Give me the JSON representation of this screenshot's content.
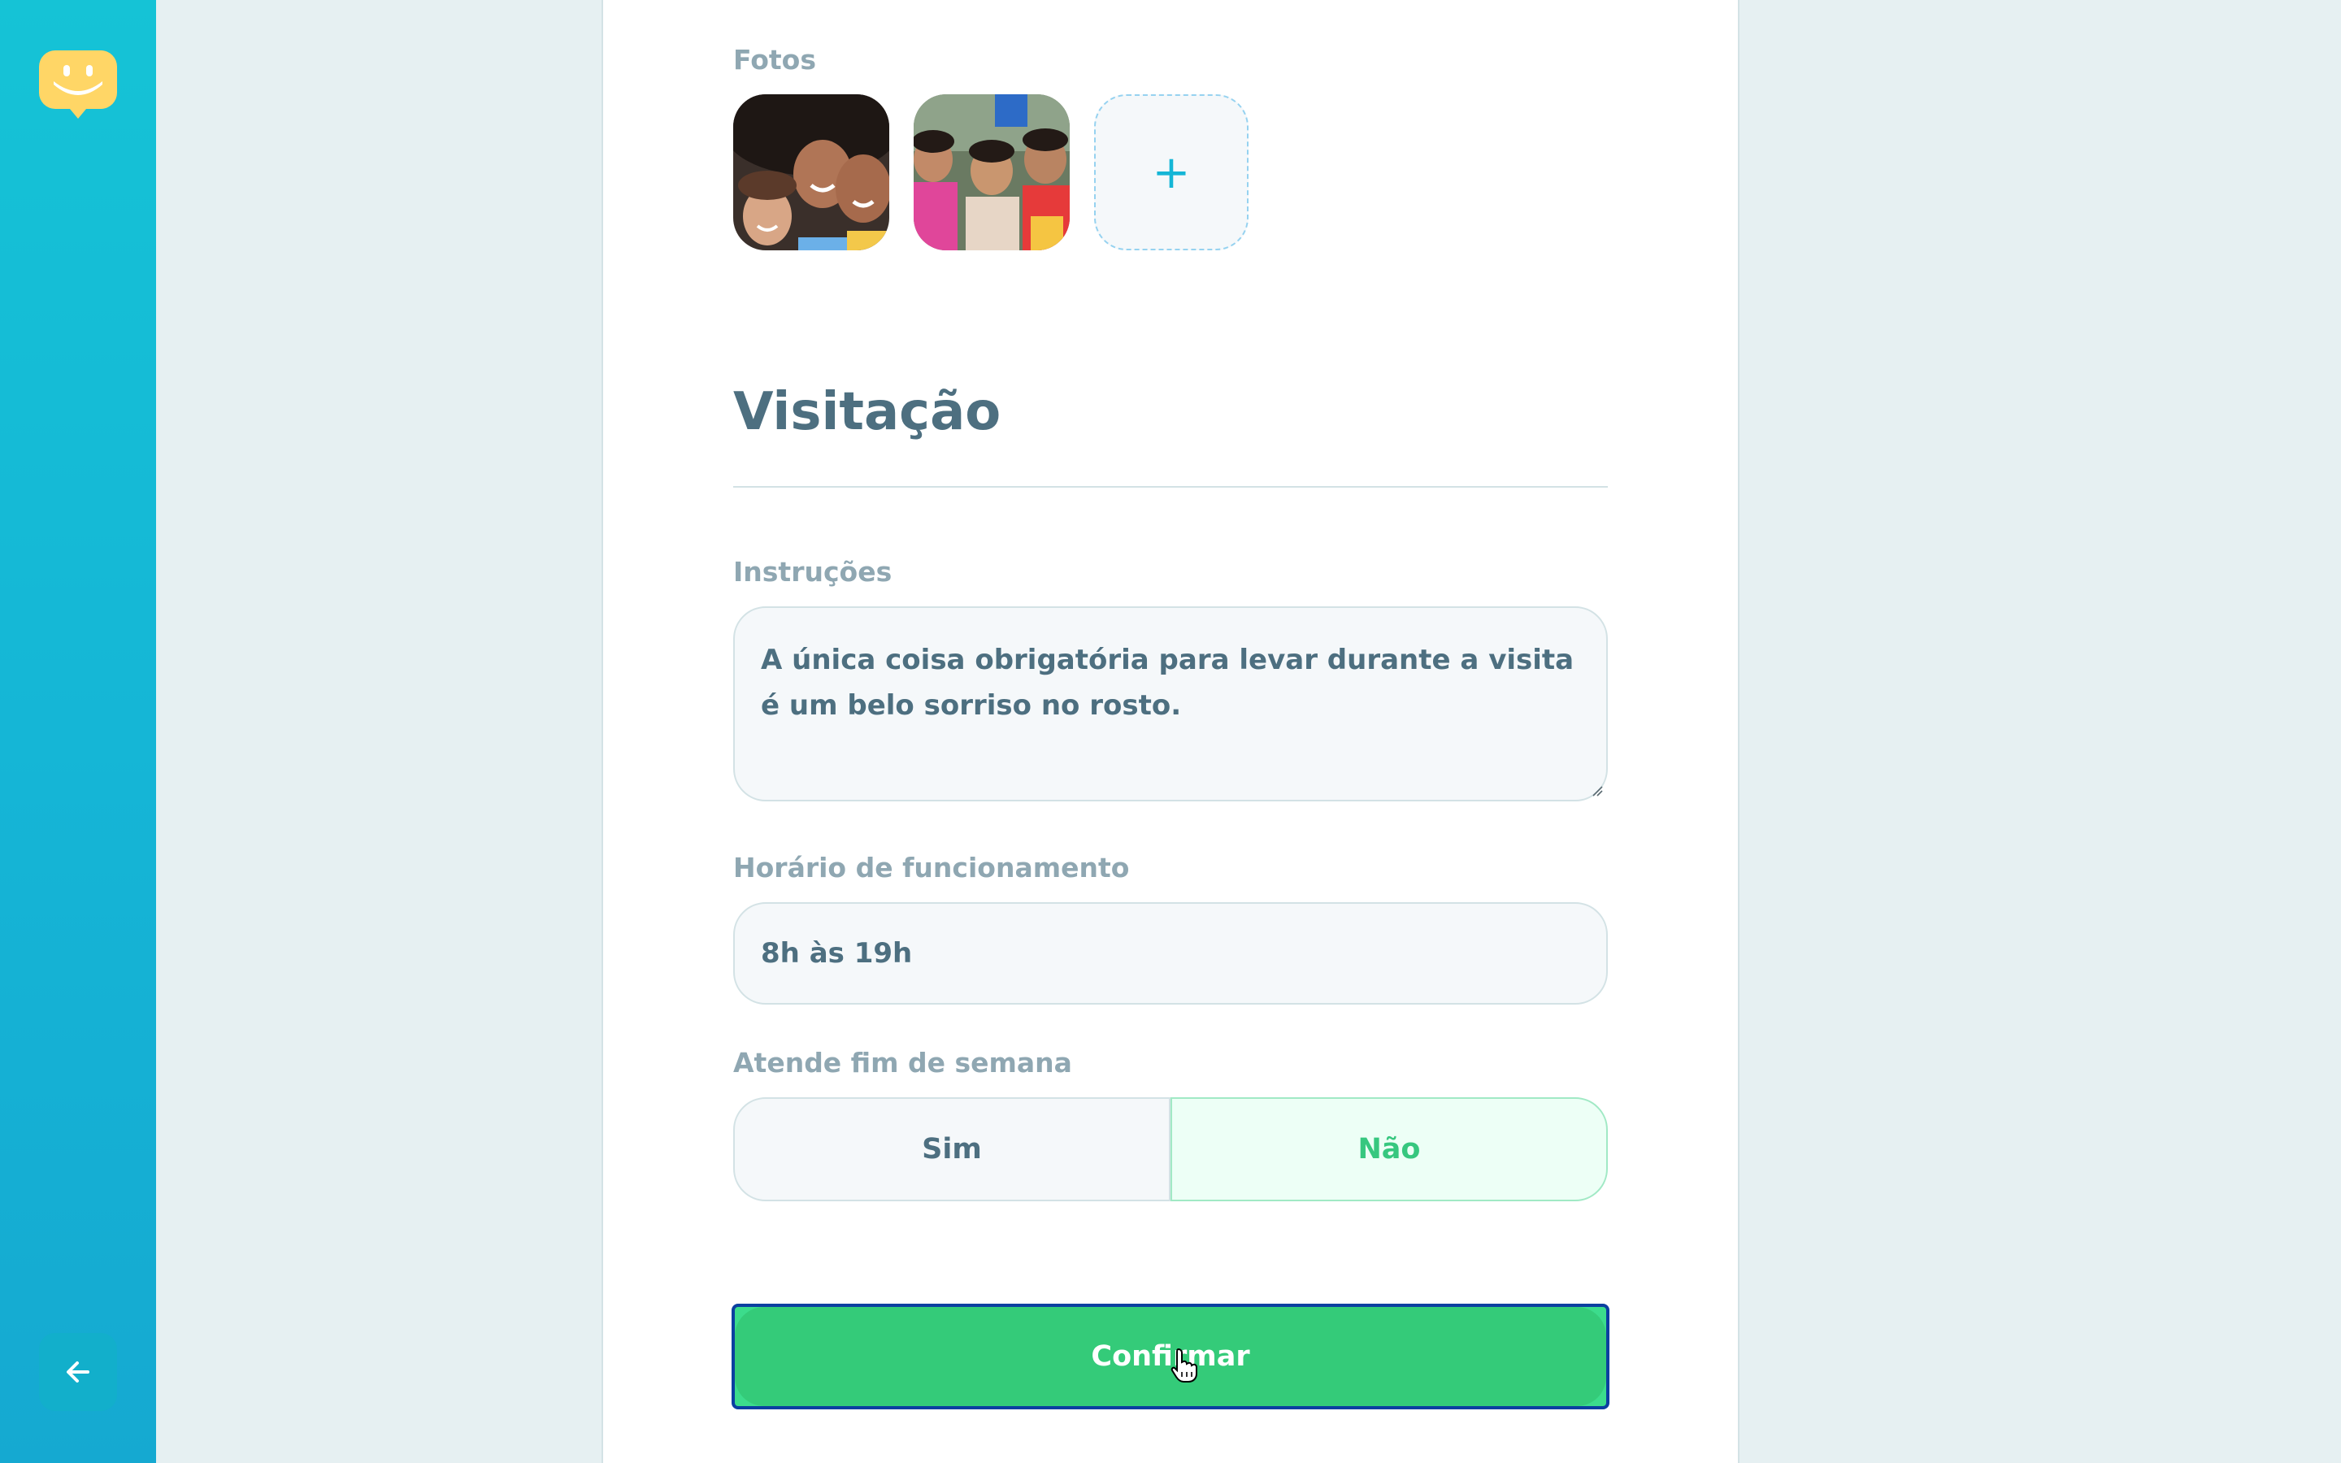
{
  "sidebar": {
    "logo_icon": "happy-face-map-pin-icon",
    "back_icon": "arrow-left-icon"
  },
  "form": {
    "photos": {
      "label": "Fotos",
      "items": [
        "kids-photo-1",
        "kids-photo-2"
      ],
      "add_label": "+"
    },
    "visitation": {
      "title": "Visitação",
      "instructions": {
        "label": "Instruções",
        "value": "A única coisa obrigatória para levar durante a visita é um belo sorriso no rosto."
      },
      "opening_hours": {
        "label": "Horário de funcionamento",
        "value": "8h às 19h"
      },
      "open_on_weekends": {
        "label": "Atende fim de semana",
        "yes_label": "Sim",
        "no_label": "Não",
        "selected": "Não"
      }
    },
    "confirm_label": "Confirmar"
  },
  "colors": {
    "sidebar_gradient_top": "#15c3d6",
    "sidebar_gradient_bottom": "#15a9d1",
    "logo_yellow": "#ffd666",
    "confirm_green": "#34cb79",
    "selected_green_text": "#37c77f",
    "text_primary": "#4d6f80",
    "text_label": "#8fa7b2"
  }
}
